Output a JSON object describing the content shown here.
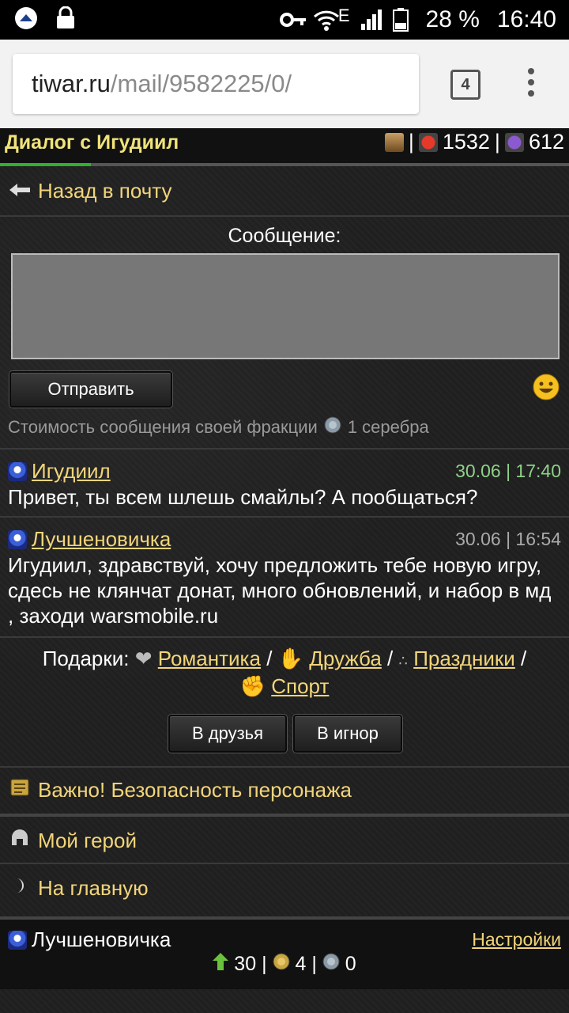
{
  "statusbar": {
    "battery": "28 %",
    "time": "16:40",
    "network": "E"
  },
  "browser": {
    "url_host": "tiwar.ru",
    "url_path": "/mail/9582225/0/",
    "tab_count": "4"
  },
  "header": {
    "title": "Диалог с Игудиил",
    "sep1": "|",
    "health": "1532",
    "sep2": "|",
    "energy": "612",
    "progress_fraction": 0.16
  },
  "nav": {
    "back_label": "Назад в почту"
  },
  "compose": {
    "label": "Сообщение:",
    "textarea_value": "",
    "send_label": "Отправить",
    "cost_text": "Стоимость сообщения своей фракции",
    "cost_value": "1 серебра"
  },
  "messages": [
    {
      "author": "Игудиил",
      "time": "30.06 | 17:40",
      "text": "Привет, ты всем шлешь смайлы? А пообщаться?"
    },
    {
      "author": "Лучшеновичка",
      "time": "30.06 | 16:54",
      "text": "Игудиил, здравствуй, хочу предложить тебе новую игру, сдесь не клянчат донат, много обновлений, и набор в мд , заходи warsmobile.ru"
    }
  ],
  "gifts": {
    "label": "Подарки:",
    "romance": "Романтика",
    "slash": "/",
    "friendship": "Дружба",
    "holidays": "Праздники",
    "sport": "Спорт"
  },
  "actions": {
    "friends": "В друзья",
    "ignore": "В игнор"
  },
  "important": "Важно! Безопасность персонажа",
  "menu": {
    "hero": "Мой герой",
    "home": "На главную"
  },
  "footer": {
    "name": "Лучшеновичка",
    "settings": "Настройки",
    "level": "30",
    "gold": "4",
    "silver": "0",
    "sep": "|"
  },
  "colors": {
    "accent_gold": "#f2d57a",
    "time_green": "#8fd18a",
    "time_gray": "#aaaaaa"
  }
}
